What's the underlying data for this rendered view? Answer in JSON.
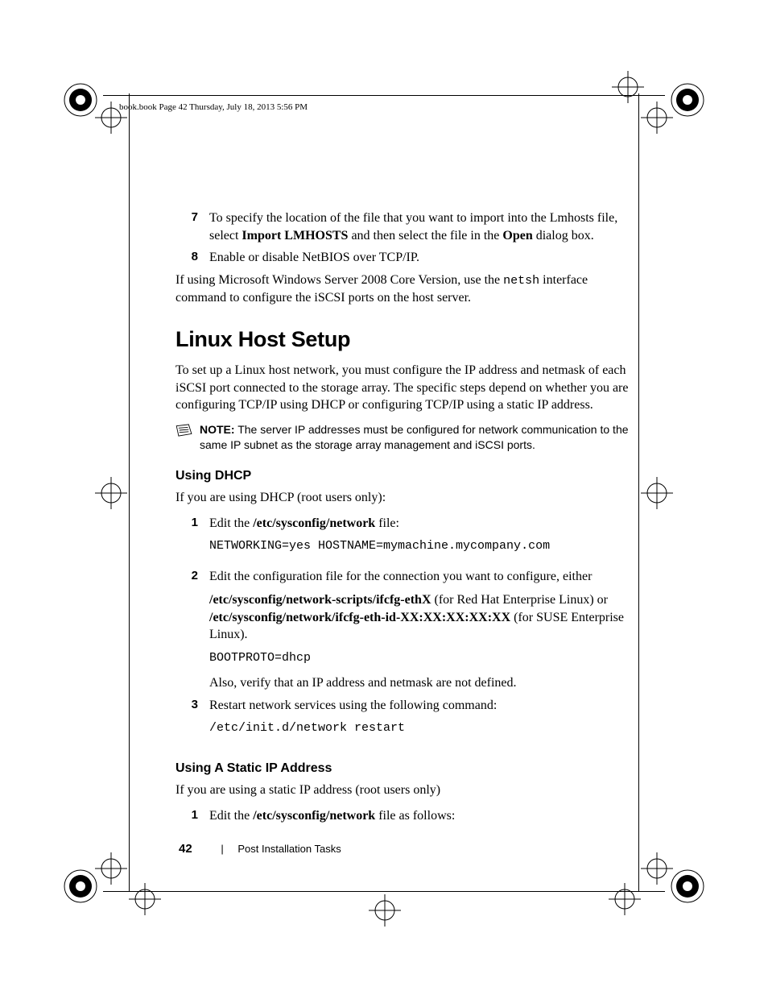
{
  "header": "book.book  Page 42  Thursday, July 18, 2013  5:56 PM",
  "step7_num": "7",
  "step7_a": "To specify the location of the file that you want to import into the Lmhosts file, select ",
  "step7_b": "Import LMHOSTS",
  "step7_c": " and then select the file in the ",
  "step7_d": "Open",
  "step7_e": " dialog box.",
  "step8_num": "8",
  "step8": "Enable or disable NetBIOS over TCP/IP.",
  "para_netsh_a": "If using Microsoft Windows Server 2008 Core Version, use the ",
  "para_netsh_code": "netsh",
  "para_netsh_b": " interface command to configure the iSCSI ports on the host server.",
  "h1": "Linux Host Setup",
  "para_linux": "To set up a Linux host network, you must configure the IP address and netmask of each iSCSI port connected to the storage array. The specific steps depend on whether you are configuring TCP/IP using DHCP or configuring TCP/IP using a static IP address.",
  "note_label": "NOTE:",
  "note_text": " The server IP addresses must be configured for network communication to the same IP subnet as the storage array management and iSCSI ports.",
  "h2_dhcp": "Using DHCP",
  "para_dhcp": "If you are using DHCP (root users only):",
  "d1_num": "1",
  "d1_a": "Edit the ",
  "d1_b": "/etc/sysconfig/network",
  "d1_c": " file:",
  "d1_code": "NETWORKING=yes HOSTNAME=mymachine.mycompany.com",
  "d2_num": "2",
  "d2_a": "Edit the configuration file for the connection you want to configure, either",
  "d2_b": "/etc/sysconfig/network-scripts/ifcfg-ethX",
  "d2_c": " (for Red Hat Enterprise Linux) or ",
  "d2_d": "/etc/sysconfig/network/ifcfg-eth-id-XX:XX:XX:XX:XX",
  "d2_e": " (for SUSE Enterprise Linux).",
  "d2_code": "BOOTPROTO=dhcp",
  "d2_also": "Also, verify that an IP address and netmask are not defined.",
  "d3_num": "3",
  "d3_a": "Restart network services using the following command:",
  "d3_code": "/etc/init.d/network  restart",
  "h2_static": "Using A Static IP Address",
  "para_static": "If you are using a static IP address (root users only)",
  "s1_num": "1",
  "s1_a": "Edit the ",
  "s1_b": "/etc/sysconfig/network",
  "s1_c": " file as follows:",
  "footer_page": "42",
  "footer_sep": "|",
  "footer_section": "Post Installation Tasks"
}
